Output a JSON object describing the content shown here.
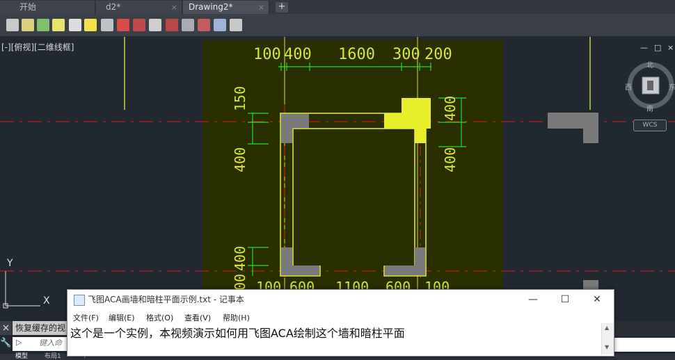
{
  "tabs": [
    {
      "label": "开始"
    },
    {
      "label": "d2*"
    },
    {
      "label": "Drawing2*"
    }
  ],
  "new_tab_label": "+",
  "tab_close_glyph": "×",
  "viewport": {
    "label": "[-][俯视][二维线框]"
  },
  "viewcube": {
    "north": "北",
    "south": "南",
    "east": "东",
    "west": "西",
    "wcs": "WCS"
  },
  "viewport_controls": {
    "minimize": "—",
    "restore": "□",
    "close": "×"
  },
  "ucs": {
    "x": "X",
    "y": "Y"
  },
  "dimensions": {
    "top": [
      "100",
      "400",
      "1600",
      "300",
      "200"
    ],
    "left": [
      "150",
      "400",
      "400",
      "00"
    ],
    "right": [
      "400",
      "400"
    ],
    "bottom": [
      "100",
      "600",
      "1100",
      "600",
      "100"
    ]
  },
  "colors": {
    "canvas_bg": "#2a2f00",
    "wall_line": "#e8f04a",
    "dim_line": "#22dd22",
    "axis_line": "#d62020",
    "column": "#7a7a7a",
    "highlight_col": "#e6ef2a"
  },
  "notepad": {
    "title": "飞图ACA画墙和暗柱平面示例.txt - 记事本",
    "minimize": "—",
    "maximize": "☐",
    "close": "✕",
    "menu": [
      "文件(F)",
      "编辑(E)",
      "格式(O)",
      "查看(V)",
      "帮助(H)"
    ],
    "content": "这个是一个实例，本视频演示如何用飞图ACA绘制这个墙和暗柱平面"
  },
  "command": {
    "close_label": "×",
    "history_text": "恢复缓存的视",
    "prompt_icon": "▷",
    "input_placeholder": "键入命",
    "settings_icon": "🔧"
  },
  "layout_tabs": [
    "模型",
    "布局1",
    "+"
  ]
}
